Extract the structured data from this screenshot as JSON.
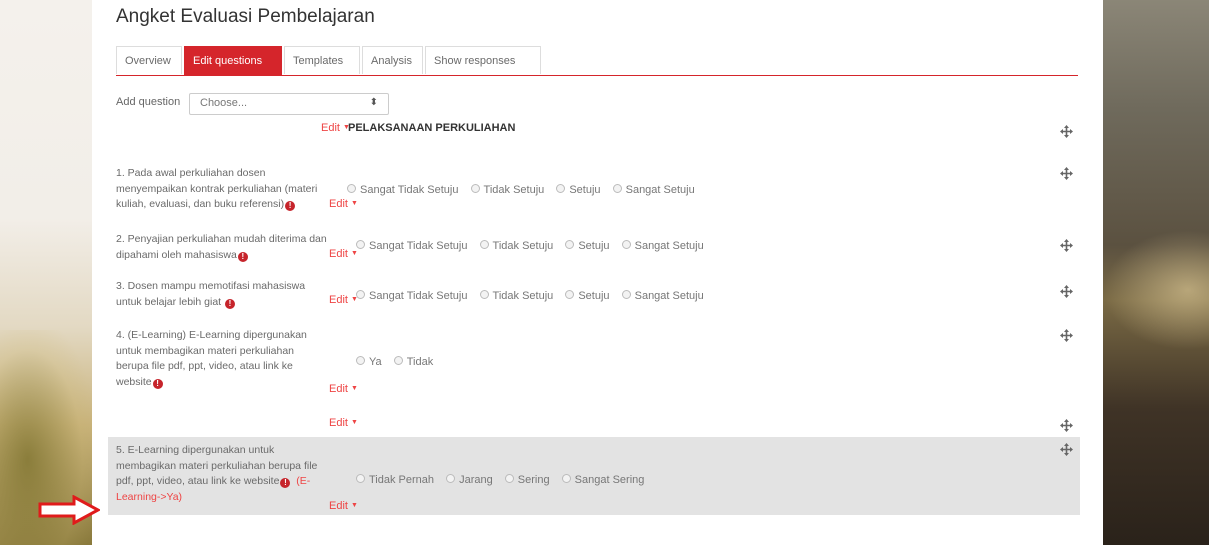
{
  "page": {
    "title": "Angket Evaluasi Pembelajaran"
  },
  "tabs": [
    {
      "label": "Overview",
      "active": false
    },
    {
      "label": "Edit questions",
      "active": true
    },
    {
      "label": "Templates",
      "active": false
    },
    {
      "label": "Analysis",
      "active": false
    },
    {
      "label": "Show responses",
      "active": false
    }
  ],
  "add_question": {
    "label": "Add question",
    "selected": "Choose..."
  },
  "edit_label": "Edit",
  "section": {
    "label": "PELAKSANAAN PERKULIAHAN"
  },
  "questions": [
    {
      "text_lines": [
        "1. Pada awal perkuliahan dosen",
        "menyempaikan kontrak perkuliahan (materi",
        "kuliah, evaluasi, dan buku referensi)"
      ],
      "options": [
        "Sangat Tidak Setuju",
        "Tidak Setuju",
        "Setuju",
        "Sangat Setuju"
      ]
    },
    {
      "text_lines": [
        "2. Penyajian perkuliahan mudah diterima dan",
        "dipahami oleh mahasiswa"
      ],
      "options": [
        "Sangat Tidak Setuju",
        "Tidak Setuju",
        "Setuju",
        "Sangat Setuju"
      ]
    },
    {
      "text_lines": [
        "3. Dosen mampu memotifasi mahasiswa",
        "untuk belajar lebih giat"
      ],
      "options": [
        "Sangat Tidak Setuju",
        "Tidak Setuju",
        "Setuju",
        "Sangat Setuju"
      ]
    },
    {
      "text_lines": [
        "4. (E-Learning) E-Learning dipergunakan",
        "untuk membagikan materi perkuliahan",
        "berupa file pdf, ppt, video, atau link ke",
        "website"
      ],
      "options": [
        "Ya",
        "Tidak"
      ]
    },
    {
      "text_lines": [
        "5. E-Learning dipergunakan untuk",
        "membagikan materi perkuliahan berupa file",
        "pdf, ppt, video, atau link ke website"
      ],
      "dependency_1": "(E-",
      "dependency_2": "Learning->Ya)",
      "options": [
        "Tidak Pernah",
        "Jarang",
        "Sering",
        "Sangat Sering"
      ]
    }
  ],
  "error_mark": "!",
  "colors": {
    "accent": "#d5252b",
    "edit": "#e44444",
    "highlight_row": "#e3e3e3"
  }
}
